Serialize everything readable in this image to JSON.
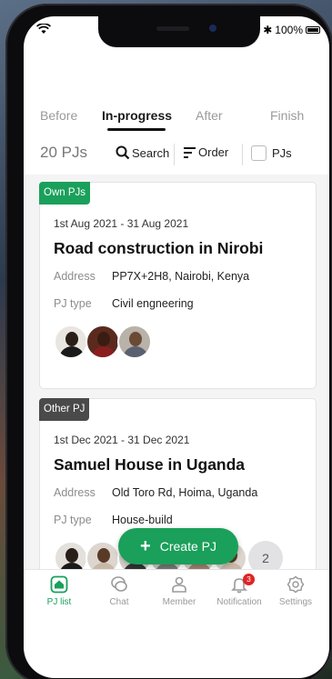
{
  "status": {
    "battery": "100%"
  },
  "tabs": [
    {
      "label": "Before"
    },
    {
      "label": "In-progress"
    },
    {
      "label": "After"
    },
    {
      "label": "Finish"
    }
  ],
  "toolbar": {
    "count": "20 PJs",
    "search_label": "Search",
    "order_label": "Order",
    "pjs_filter_label": "PJs"
  },
  "labels": {
    "address": "Address",
    "pj_type": "PJ type"
  },
  "projects": [
    {
      "tag": "Own PJs",
      "tag_color": "#1aa05a",
      "dates": "1st Aug 2021 -  31 Aug 2021",
      "title": "Road construction in Nirobi",
      "address": "PP7X+2H8, Nairobi, Kenya",
      "pj_type": "Civil engneering"
    },
    {
      "tag": "Other PJ",
      "tag_color": "#4a4a4a",
      "dates": "1st Dec 2021 -  31 Dec 2021",
      "title": "Samuel House in Uganda",
      "address": "Old Toro Rd, Hoima, Uganda",
      "pj_type": "House-build",
      "more_members": "2"
    }
  ],
  "fab": {
    "label": "Create PJ"
  },
  "nav": [
    {
      "label": "PJ list"
    },
    {
      "label": "Chat"
    },
    {
      "label": "Member"
    },
    {
      "label": "Notification",
      "badge": "3"
    },
    {
      "label": "Settings"
    }
  ],
  "colors": {
    "accent": "#1aa05a",
    "badge": "#e02424"
  }
}
